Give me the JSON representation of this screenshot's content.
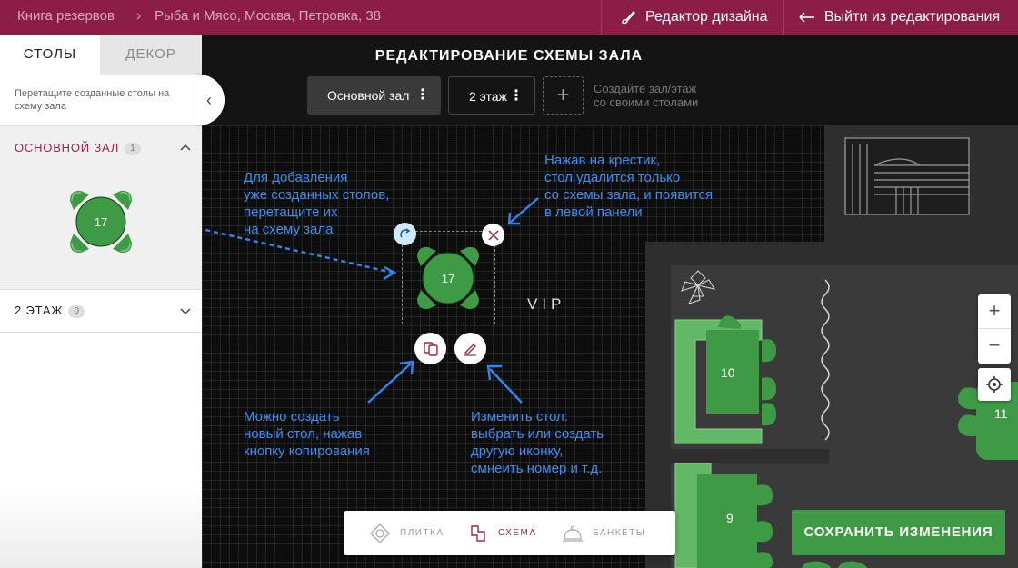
{
  "topbar": {
    "breadcrumb_root": "Книга резервов",
    "breadcrumb_sep": "›",
    "breadcrumb_restaurant": "Рыба и Мясо, Москва, Петровка, 38",
    "design_editor_label": "Редактор дизайна",
    "exit_edit_label": "Выйти из редактирования"
  },
  "sidebar": {
    "tab_tables": "СТОЛЫ",
    "tab_decor": "ДЕКОР",
    "hint": "Перетащите созданные столы на схему зала",
    "section1": {
      "title": "ОСНОВНОЙ ЗАЛ",
      "count": "1",
      "table_number": "17"
    },
    "section2": {
      "title": "2 ЭТАЖ",
      "count": "0"
    },
    "collapse_icon": "‹"
  },
  "header": {
    "title": "РЕДАКТИРОВАНИЕ СХЕМЫ ЗАЛА",
    "hall_main": "Основной зал",
    "hall_floor2": "2 этаж",
    "menu_dots": "⋮",
    "add_symbol": "+",
    "add_hint": "Создайте зал/этаж\nсо своими столами"
  },
  "canvas": {
    "notes": {
      "drag": "Для добавления\nуже созданных столов,\nперетащите их\nна схему зала",
      "delete": "Нажав на крестик,\nстол удалится только\nсо схемы зала, и появится\nв левой панели",
      "copy": "Можно создать\nновый стол, нажав\nкнопку копирования",
      "edit": "Изменить стол:\nвыбрать или создать\nдругую иконку,\nсмнеить номер и т.д."
    },
    "selected_table_number": "17",
    "vip_label": "VIP",
    "table_10": "10",
    "table_11": "11",
    "table_9": "9"
  },
  "zoom": {
    "plus": "+",
    "minus": "−"
  },
  "viewbar": {
    "tile": "ПЛИТКА",
    "scheme": "СХЕМА",
    "banquets": "БАНКЕТЫ"
  },
  "actions": {
    "save": "СОХРАНИТЬ ИЗМЕНЕНИЯ"
  },
  "colors": {
    "brand": "#8c1d46",
    "table_green": "#3f9a45",
    "note_blue": "#3d8ef0"
  }
}
